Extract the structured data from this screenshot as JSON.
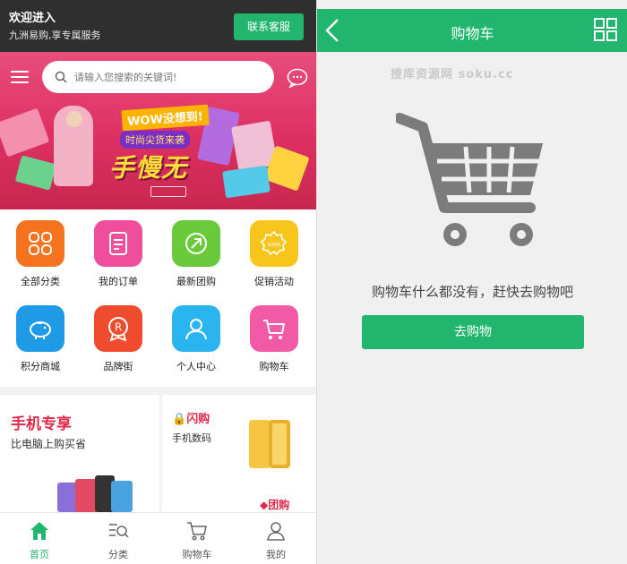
{
  "left": {
    "header": {
      "welcome": "欢迎进入",
      "subtitle": "九洲易购,享专属服务",
      "service_button": "联系客服"
    },
    "search": {
      "placeholder": "请输入您搜索的关键词!"
    },
    "banner": {
      "tag": "WOW没想到!",
      "sub": "时尚尖货来袭",
      "headline": "手慢无"
    },
    "categories": [
      {
        "label": "全部分类",
        "icon": "grid-icon",
        "color": "#f5731f"
      },
      {
        "label": "我的订单",
        "icon": "order-icon",
        "color": "#ee4e9b"
      },
      {
        "label": "最新团购",
        "icon": "arrow-circle-icon",
        "color": "#6bc93c"
      },
      {
        "label": "促销活动",
        "icon": "sale-badge-icon",
        "color": "#f7c51c"
      },
      {
        "label": "积分商城",
        "icon": "piggy-bank-icon",
        "color": "#1f9ae6"
      },
      {
        "label": "品牌街",
        "icon": "brand-r-icon",
        "color": "#ef4b2e"
      },
      {
        "label": "个人中心",
        "icon": "user-icon",
        "color": "#2ab4f0"
      },
      {
        "label": "购物车",
        "icon": "cart-icon",
        "color": "#f25aa8"
      }
    ],
    "promo": {
      "title": "手机专享",
      "subtitle": "比电脑上购买省",
      "flash_label": "闪购",
      "flash_sub": "手机数码",
      "group_label": "团购"
    },
    "tabbar": [
      {
        "label": "首页",
        "icon": "home-icon",
        "active": true
      },
      {
        "label": "分类",
        "icon": "category-search-icon",
        "active": false
      },
      {
        "label": "购物车",
        "icon": "cart-icon",
        "active": false
      },
      {
        "label": "我的",
        "icon": "user-icon",
        "active": false
      }
    ]
  },
  "right": {
    "title": "购物车",
    "watermark": "搜库资源网 soku.cc",
    "empty_message": "购物车什么都没有，赶快去购物吧",
    "go_shopping": "去购物"
  },
  "colors": {
    "primary_green": "#21b56e",
    "promo_red": "#e02a4a",
    "hero_pink": "#dd2f62"
  }
}
